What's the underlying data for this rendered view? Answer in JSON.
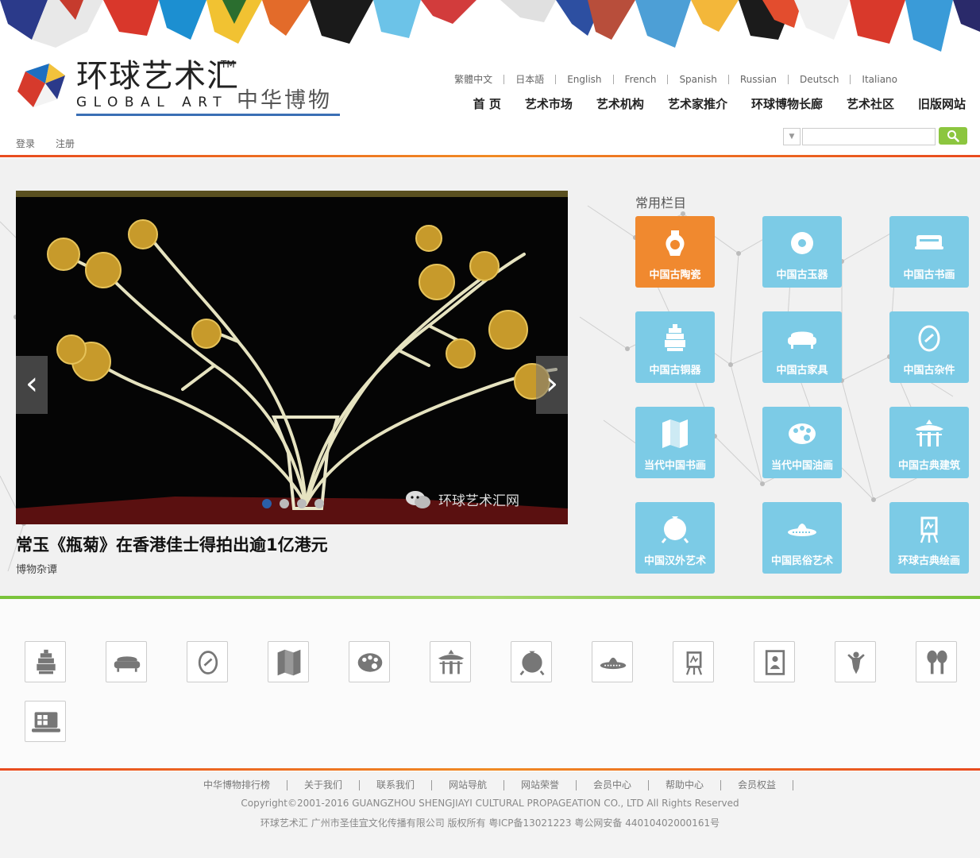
{
  "brand": {
    "name_cn": "环球艺术汇",
    "tm": "TM",
    "name_en": "GLOBAL ART",
    "subtitle": "中华博物"
  },
  "languages": [
    "繁體中文",
    "日本語",
    "English",
    "French",
    "Spanish",
    "Russian",
    "Deutsch",
    "Italiano"
  ],
  "nav": [
    "首 页",
    "艺术市场",
    "艺术机构",
    "艺术家推介",
    "环球博物长廊",
    "艺术社区",
    "旧版网站"
  ],
  "auth": {
    "login": "登录",
    "register": "注册"
  },
  "search": {
    "select_arrow": "▼",
    "placeholder": ""
  },
  "slider": {
    "prev": "‹",
    "next": "›",
    "watermark": "环球艺术汇网",
    "dots": 4,
    "active_dot": 0
  },
  "news": {
    "title": "常玉《瓶菊》在香港佳士得拍出逾1亿港元",
    "category": "博物杂谭"
  },
  "common": {
    "title": "常用栏目",
    "tiles": [
      {
        "label": "中国古陶瓷",
        "icon": "vase-icon",
        "active": true
      },
      {
        "label": "中国古玉器",
        "icon": "jade-disc-icon",
        "active": false
      },
      {
        "label": "中国古书画",
        "icon": "scroll-icon",
        "active": false
      },
      {
        "label": "中国古铜器",
        "icon": "bronze-pagoda-icon",
        "active": false
      },
      {
        "label": "中国古家具",
        "icon": "sofa-icon",
        "active": false
      },
      {
        "label": "中国古杂件",
        "icon": "mirror-icon",
        "active": false
      },
      {
        "label": "当代中国书画",
        "icon": "map-icon",
        "active": false
      },
      {
        "label": "当代中国油画",
        "icon": "palette-icon",
        "active": false
      },
      {
        "label": "中国古典建筑",
        "icon": "pavilion-icon",
        "active": false
      },
      {
        "label": "中国汉外艺术",
        "icon": "pot-icon",
        "active": false
      },
      {
        "label": "中国民俗艺术",
        "icon": "sombrero-icon",
        "active": false
      },
      {
        "label": "环球古典绘画",
        "icon": "easel-icon",
        "active": false
      }
    ]
  },
  "bottom_icons": [
    "bronze-pagoda-icon",
    "sofa-icon",
    "mirror-icon",
    "map-icon",
    "palette-icon",
    "pavilion-icon",
    "pot-icon",
    "sombrero-icon",
    "easel-icon",
    "portrait-icon",
    "statue-icon",
    "maracas-icon",
    "computer-icon"
  ],
  "footer": {
    "links": [
      "中华博物排行榜",
      "关于我们",
      "联系我们",
      "网站导航",
      "网站荣誉",
      "会员中心",
      "帮助中心",
      "会员权益"
    ],
    "copyright": "Copyright©2001-2016 GUANGZHOU SHENGJIAYI CULTURAL PROPAGEATION CO., LTD All Rights Reserved",
    "icp": "环球艺术汇 广州市圣佳宜文化传播有限公司 版权所有 粤ICP备13021223 粤公网安备 44010402000161号"
  },
  "colors": {
    "accent_orange": "#f0892f",
    "tile_blue": "#7ccbe6",
    "search_green": "#8cc63f",
    "red_line": "#e84b1f",
    "green_line": "#79c33a",
    "logo_blue": "#3a6fb5"
  }
}
